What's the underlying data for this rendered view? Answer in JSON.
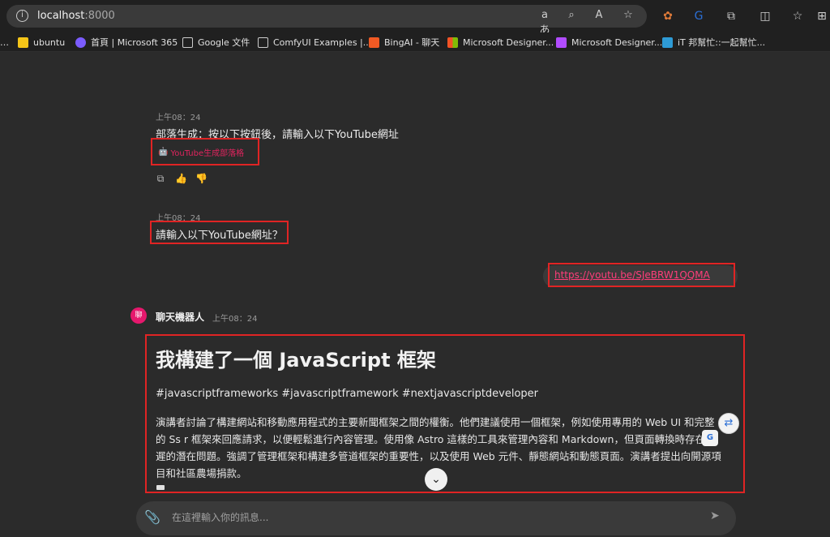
{
  "browser": {
    "url_host": "localhost",
    "url_port": ":8000",
    "bookmarks": [
      {
        "label": "ubuntu",
        "color": "#f5c518"
      },
      {
        "label": "首頁 | Microsoft 365",
        "color": "#7b5cff"
      },
      {
        "label": "Google 文件",
        "color": "#e0e0e0"
      },
      {
        "label": "ComfyUI Examples |...",
        "color": "#e0e0e0"
      },
      {
        "label": "BingAI - 聊天",
        "color": "#f15a24"
      },
      {
        "label": "Microsoft Designer...",
        "color": "#00a4ef"
      },
      {
        "label": "Microsoft Designer...",
        "color": "#b14cff"
      },
      {
        "label": "iT 邦幫忙::一起幫忙...",
        "color": "#2e9bd6"
      }
    ]
  },
  "chat": {
    "msg1_time": "上午08：24",
    "msg1_text": "部落生成：按以下按鈕後，請輸入以下YouTube網址",
    "msg1_button": "YouTube生成部落格",
    "msg2_time": "上午08：24",
    "msg2_text": "請輸入以下YouTube網址？",
    "user_link": "https://youtu.be/SJeBRW1QQMA",
    "bot_name": "聊天機器人",
    "bot_time": "上午08：24",
    "bot_avatar": "聊",
    "article_title": "我構建了一個 JavaScript 框架",
    "hashtags": "#javascriptframeworks #javascriptframework #nextjavascriptdeveloper",
    "body": "演講者討論了構建網站和移動應用程式的主要新聞框架之間的權衡。他們建議使用一個框架，例如使用專用的 Web UI 和完整的 Ss r 框架來回應請求，以便輕鬆進行內容管理。使用像 Astro 這樣的工具來管理內容和 Markdown，但頁面轉換時存在延遲的潛在問題。強調了管理框架和構建多管道框架的重要性，以及使用 Web 元件、靜態網站和動態頁面。演講者提出向開源項目和社區農場捐款。",
    "input_placeholder": "在這裡輸入你的訊息..."
  }
}
